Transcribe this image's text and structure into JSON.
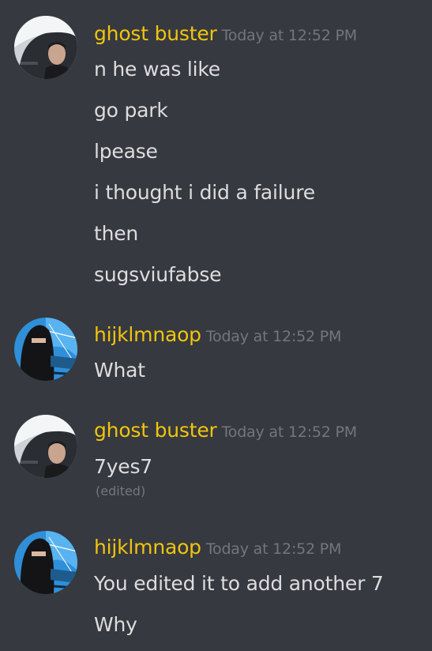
{
  "groups": [
    {
      "username": "ghost buster",
      "timestamp": "Today at 12:52 PM",
      "lines": [
        "n he was like",
        "go park",
        "lpease",
        "i thought i did a failure",
        "then",
        "sugsviufabse"
      ]
    },
    {
      "username": "hijklmnaop",
      "timestamp": "Today at 12:52 PM",
      "lines": [
        "What"
      ]
    },
    {
      "username": "ghost buster",
      "timestamp": "Today at 12:52 PM",
      "lines": [
        "7yes7"
      ],
      "edited_label": "(edited)"
    },
    {
      "username": "hijklmnaop",
      "timestamp": "Today at 12:52 PM",
      "lines": [
        "You edited it to add another 7",
        "Why"
      ]
    }
  ],
  "colors": {
    "background": "#36393f",
    "username": "#f1c40f",
    "text": "#dcddde",
    "muted": "#72767d"
  }
}
